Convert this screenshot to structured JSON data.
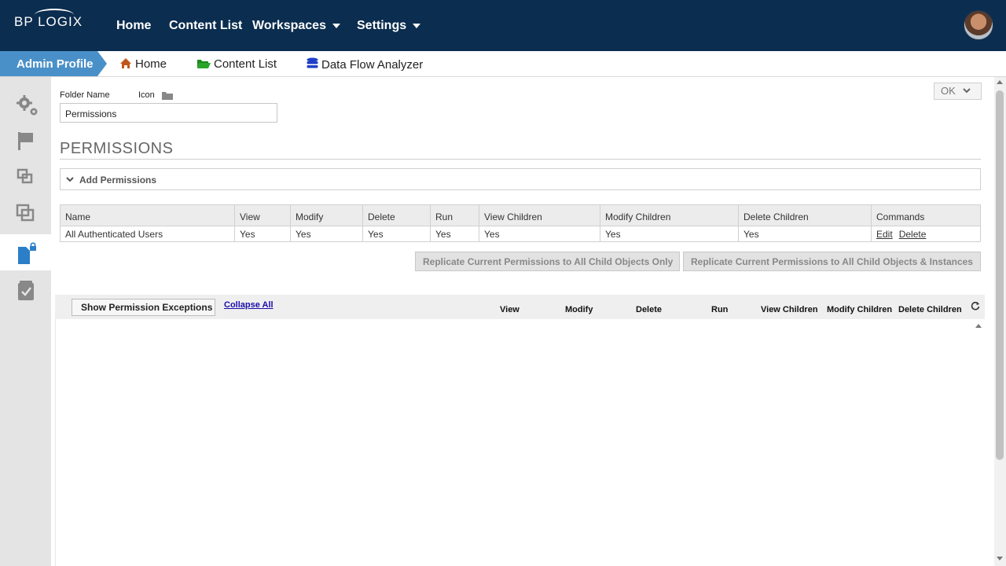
{
  "topnav": {
    "brand": "BP LOGIX",
    "items": [
      {
        "label": "Home"
      },
      {
        "label": "Content List"
      },
      {
        "label": "Workspaces"
      },
      {
        "label": "Settings"
      }
    ],
    "background": "#0b2d4f"
  },
  "breadcrumb": {
    "active": "Admin Profile",
    "items": [
      {
        "label": "Home",
        "icon": "home-icon"
      },
      {
        "label": "Content List",
        "icon": "folder-open-icon"
      },
      {
        "label": "Data Flow Analyzer",
        "icon": "database-icon"
      }
    ],
    "accent": "#4a90c8"
  },
  "sidebar": {
    "items": [
      {
        "icon": "gears-icon"
      },
      {
        "icon": "flag-icon"
      },
      {
        "icon": "window-restore-icon"
      },
      {
        "icon": "clone-icon"
      },
      {
        "icon": "file-lock-icon",
        "active": true
      },
      {
        "icon": "task-check-icon"
      }
    ]
  },
  "form": {
    "folder_name_label": "Folder Name",
    "icon_label": "Icon",
    "folder_name_value": "Permissions",
    "ok_label": "OK"
  },
  "permissions": {
    "title": "PERMISSIONS",
    "add_label": "Add Permissions",
    "columns": [
      "Name",
      "View",
      "Modify",
      "Delete",
      "Run",
      "View Children",
      "Modify Children",
      "Delete Children",
      "Commands"
    ],
    "rows": [
      {
        "name": "All Authenticated Users",
        "view": "Yes",
        "modify": "Yes",
        "delete": "Yes",
        "run": "Yes",
        "view_children": "Yes",
        "modify_children": "Yes",
        "delete_children": "Yes",
        "edit_label": "Edit",
        "delete_label": "Delete"
      }
    ],
    "replicate_only_label": "Replicate Current Permissions to All Child Objects Only",
    "replicate_instances_label": "Replicate Current Permissions to All Child Objects & Instances"
  },
  "exceptions": {
    "show_label": "Show Permission Exceptions",
    "collapse_label": "Collapse All",
    "columns": [
      "View",
      "Modify",
      "Delete",
      "Run",
      "View Children",
      "Modify Children",
      "Delete Children"
    ]
  }
}
